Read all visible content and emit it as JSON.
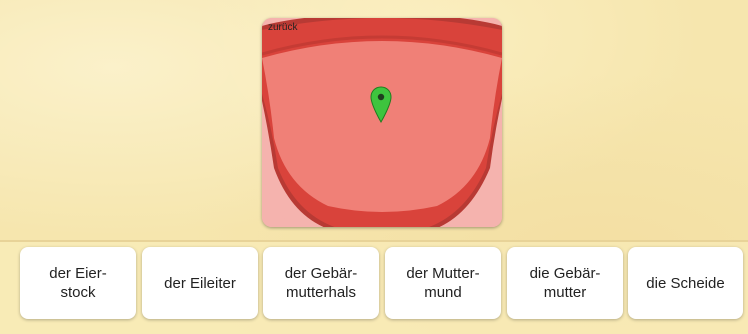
{
  "image_card": {
    "back_label": "zurück",
    "marker_icon": "map-pin-icon",
    "marker_color": "#3ec43e"
  },
  "answers": [
    {
      "label": "der Eier-\nstock"
    },
    {
      "label": "der Eileiter"
    },
    {
      "label": "der Gebär-\nmutterhals"
    },
    {
      "label": "der Mutter-\nmund"
    },
    {
      "label": "die Gebär-\nmutter"
    },
    {
      "label": "die Scheide"
    }
  ],
  "colors": {
    "background": "#f6e6ae",
    "tissue_light": "#f08077",
    "tissue_dark": "#d9433b",
    "outer_pink": "#f5b3ae"
  }
}
